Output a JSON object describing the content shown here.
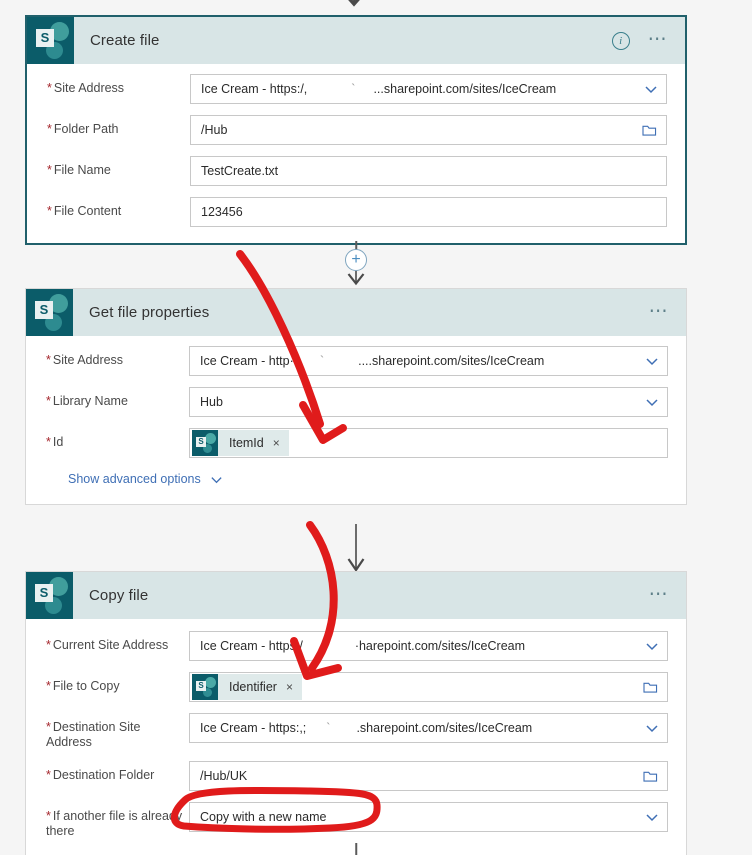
{
  "app": {
    "connector_name": "SharePoint",
    "logo_letter": "S"
  },
  "cards": [
    {
      "id": "create-file",
      "title": "Create file",
      "selected": true,
      "header_icons": [
        "info-icon",
        "ellipsis-icon"
      ],
      "fields": [
        {
          "label": "Site Address",
          "required": true,
          "value_prefix": "Ice Cream - https:/,",
          "value_tick": "`",
          "value_suffix": "...sharepoint.com/sites/IceCream",
          "control": "dropdown"
        },
        {
          "label": "Folder Path",
          "required": true,
          "value": "/Hub",
          "control": "folder-picker"
        },
        {
          "label": "File Name",
          "required": true,
          "value": "TestCreate.txt",
          "control": "text"
        },
        {
          "label": "File Content",
          "required": true,
          "value": "123456",
          "control": "text"
        }
      ]
    },
    {
      "id": "get-file-properties",
      "title": "Get file properties",
      "selected": false,
      "header_icons": [
        "ellipsis-icon"
      ],
      "fields": [
        {
          "label": "Site Address",
          "required": true,
          "value_prefix": "Ice Cream - http··",
          "value_tick": "`",
          "value_suffix": "....sharepoint.com/sites/IceCream",
          "control": "dropdown"
        },
        {
          "label": "Library Name",
          "required": true,
          "value": "Hub",
          "control": "dropdown"
        },
        {
          "label": "Id",
          "required": true,
          "control": "token",
          "token": "ItemId",
          "token_remove": "×"
        }
      ],
      "advanced_link": "Show advanced options"
    },
    {
      "id": "copy-file",
      "title": "Copy file",
      "selected": false,
      "header_icons": [
        "ellipsis-icon"
      ],
      "fields": [
        {
          "label": "Current Site Address",
          "required": true,
          "value_prefix": "Ice Cream - https:/",
          "value_tick": "",
          "value_suffix": "·harepoint.com/sites/IceCream",
          "control": "dropdown"
        },
        {
          "label": "File to Copy",
          "required": true,
          "control": "token",
          "token": "Identifier",
          "token_remove": "×",
          "trailing": "folder-picker"
        },
        {
          "label": "Destination Site Address",
          "required": true,
          "value_prefix": "Ice Cream - https:,;",
          "value_tick": "`",
          "value_suffix": ".sharepoint.com/sites/IceCream",
          "control": "dropdown"
        },
        {
          "label": "Destination Folder",
          "required": true,
          "value": "/Hub/UK",
          "control": "folder-picker"
        },
        {
          "label": "If another file is already there",
          "required": true,
          "value": "Copy with a new name",
          "control": "dropdown",
          "highlighted": true
        }
      ]
    }
  ],
  "connectors": [
    {
      "type": "arrow",
      "id": "top-arrow"
    },
    {
      "type": "add-step",
      "id": "add-step-connector",
      "label": "+"
    },
    {
      "type": "arrow",
      "id": "arrow-between-2-3"
    },
    {
      "type": "line",
      "id": "bottom-line"
    }
  ],
  "annotations": {
    "arrow_1": "red arrow pointing to ItemId token",
    "arrow_2": "red arrow pointing to Identifier token",
    "oval_1": "red oval around Copy with a new name",
    "color": "#e01b1b"
  },
  "colors": {
    "accent_teal": "#0b5c69",
    "header_bg": "#d8e5e6",
    "selected_border": "#20606b",
    "required_star": "#a4262c",
    "link_blue": "#3f6fb5",
    "annotation_red": "#e01b1b"
  }
}
